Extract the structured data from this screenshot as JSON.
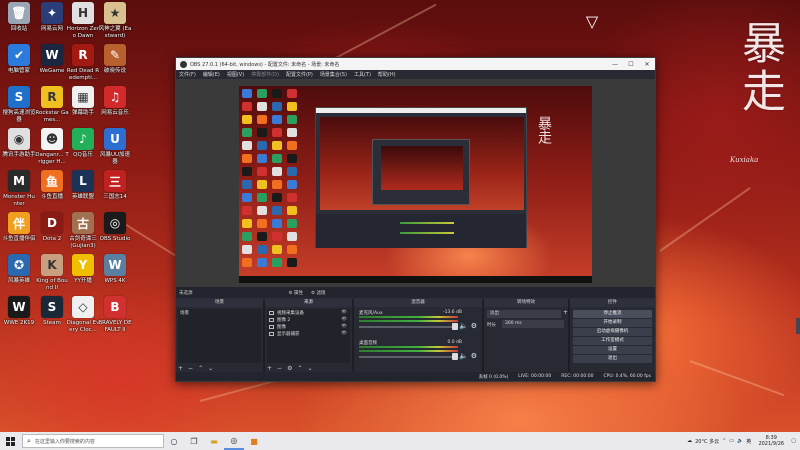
{
  "desktop": {
    "calligraphy": "暴走",
    "signature": "Kuxiaka",
    "icons": [
      {
        "label": "回收站",
        "color": "#9aa6b6",
        "glyph": "🗑"
      },
      {
        "label": "网易云网",
        "color": "#2c3e78",
        "glyph": "✦"
      },
      {
        "label": "Horizon Zero Dawn",
        "color": "#e0e0e0",
        "glyph": "H"
      },
      {
        "label": "风神之翼 (Eastward)",
        "color": "#d8c090",
        "glyph": "★"
      },
      {
        "label": "电脑管家",
        "color": "#2b7bdc",
        "glyph": "✔"
      },
      {
        "label": "WeGame",
        "color": "#1b2740",
        "glyph": "W"
      },
      {
        "label": "Red Dead Redempti...",
        "color": "#a31a12",
        "glyph": "R"
      },
      {
        "label": "破晓传说",
        "color": "#b86030",
        "glyph": "✎"
      },
      {
        "label": "搜狗高速浏览器",
        "color": "#1f70c8",
        "glyph": "S"
      },
      {
        "label": "Rockstar Games...",
        "color": "#f0c020",
        "glyph": "R"
      },
      {
        "label": "弹幕助手",
        "color": "#f0f0f0",
        "glyph": "▦"
      },
      {
        "label": "网易云音乐",
        "color": "#d22a2a",
        "glyph": "♫"
      },
      {
        "label": "腾讯手游助手",
        "color": "#e0e0e0",
        "glyph": "◉"
      },
      {
        "label": "Danganr... Trigger H...",
        "color": "#f4f4f4",
        "glyph": "☻"
      },
      {
        "label": "QQ音乐",
        "color": "#23b05a",
        "glyph": "♪"
      },
      {
        "label": "风暴UU加速器",
        "color": "#2d6fd0",
        "glyph": "U"
      },
      {
        "label": "Monster Hunter",
        "color": "#2a2a2a",
        "glyph": "M"
      },
      {
        "label": "斗鱼直播",
        "color": "#f07020",
        "glyph": "鱼"
      },
      {
        "label": "英雄联盟",
        "color": "#1c3358",
        "glyph": "L"
      },
      {
        "label": "三国志14",
        "color": "#c02020",
        "glyph": "三"
      },
      {
        "label": "斗鱼直播伴侣",
        "color": "#f0a020",
        "glyph": "伴"
      },
      {
        "label": "Dota 2",
        "color": "#8a1a14",
        "glyph": "D"
      },
      {
        "label": "古剑奇谭三 (Gujian3)",
        "color": "#a07050",
        "glyph": "古"
      },
      {
        "label": "OBS Studio",
        "color": "#1a1a1a",
        "glyph": "◎"
      },
      {
        "label": "风暴英雄",
        "color": "#2a68b0",
        "glyph": "✪"
      },
      {
        "label": "King of Bound II",
        "color": "#c8a080",
        "glyph": "K"
      },
      {
        "label": "YY开播",
        "color": "#f0c000",
        "glyph": "Y"
      },
      {
        "label": "WPS 4K",
        "color": "#5a7fa0",
        "glyph": "W"
      },
      {
        "label": "WWE 2K19",
        "color": "#1a1a1a",
        "glyph": "W"
      },
      {
        "label": "Steam",
        "color": "#1b2838",
        "glyph": "S"
      },
      {
        "label": "Diagonal Every Cloc...",
        "color": "#f0f0f0",
        "glyph": "◇"
      },
      {
        "label": "BRAVELY DEFAULT II",
        "color": "#d03030",
        "glyph": "B"
      }
    ]
  },
  "obs": {
    "title": "OBS 27.0.1 (64-bit, windows) - 配置文件: 未命名 - 场景: 未命名",
    "menu": [
      "文件(F)",
      "编辑(E)",
      "视图(V)",
      "停靠部件(D)",
      "配置文件(P)",
      "场景集合(S)",
      "工具(T)",
      "帮助(H)"
    ],
    "dock_header": {
      "no_source": "未选源",
      "properties": "属性",
      "filters": "滤镜"
    },
    "scenes": {
      "title": "场景",
      "items": [
        "场景"
      ]
    },
    "sources": {
      "title": "来源",
      "items": [
        "视频采集设备",
        "图像 2",
        "图像",
        "显示器捕获"
      ]
    },
    "mixer": {
      "title": "混音器",
      "channels": [
        {
          "name": "麦克风/Aux",
          "db": "-13.6 dB"
        },
        {
          "name": "桌面音频",
          "db": "0.0 dB"
        }
      ]
    },
    "transitions": {
      "title": "转场特效",
      "selected": "淡出",
      "duration_label": "时长",
      "duration": "300 ms"
    },
    "controls": {
      "title": "控件",
      "buttons": [
        "停止推流",
        "开始录制",
        "启动虚拟摄像机",
        "工作室模式",
        "设置",
        "退出"
      ]
    },
    "status": {
      "dropped": "丢帧 0 (0.0%)",
      "live": "LIVE: 00:00:00",
      "rec": "REC: 00:00:00",
      "cpu": "CPU: 0.4%, 60.00 fps"
    }
  },
  "taskbar": {
    "search_placeholder": "在这里输入你要搜索的内容",
    "weather": "20°C 多云",
    "time": "8:39",
    "date": "2021/9/26",
    "lang": "英"
  }
}
